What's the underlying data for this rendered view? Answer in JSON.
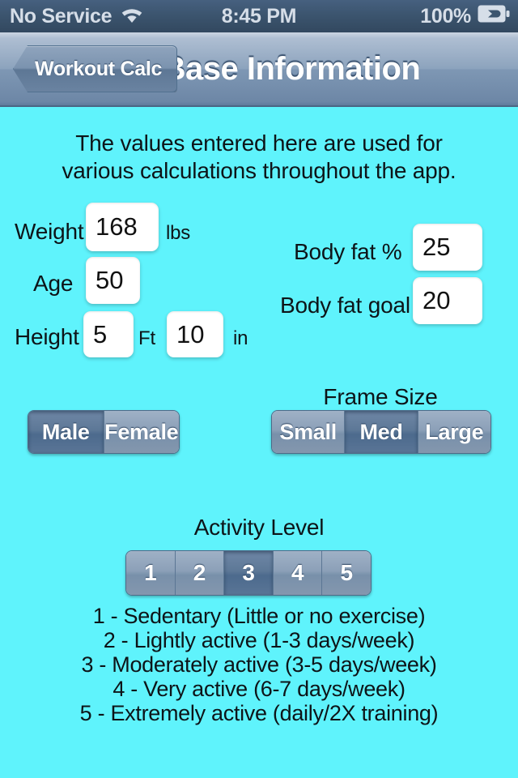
{
  "status_bar": {
    "carrier": "No Service",
    "wifi_icon": "wifi-icon",
    "time": "8:45 PM",
    "battery_percent": "100%",
    "battery_icon": "battery-charging-icon"
  },
  "nav_bar": {
    "back_label": "Workout Calc",
    "title": "Base Information"
  },
  "intro": {
    "line1": "The values entered here are used for",
    "line2": "various calculations throughout the app."
  },
  "form": {
    "weight": {
      "label": "Weight",
      "value": "168",
      "unit": "lbs"
    },
    "age": {
      "label": "Age",
      "value": "50"
    },
    "height": {
      "label": "Height",
      "feet_value": "5",
      "feet_unit": "Ft",
      "inch_value": "10",
      "inch_unit": "in"
    },
    "body_fat": {
      "label": "Body fat %",
      "value": "25"
    },
    "body_fat_goal": {
      "label": "Body fat goal",
      "value": "20"
    }
  },
  "gender": {
    "options": [
      "Male",
      "Female"
    ],
    "selected_index": 0
  },
  "frame_size": {
    "title": "Frame Size",
    "options": [
      "Small",
      "Med",
      "Large"
    ],
    "selected_index": 1
  },
  "activity": {
    "title": "Activity Level",
    "options": [
      "1",
      "2",
      "3",
      "4",
      "5"
    ],
    "selected_index": 2,
    "legend": [
      "1 - Sedentary (Little or no exercise)",
      "2 - Lightly active (1-3 days/week)",
      "3 - Moderately active (3-5 days/week)",
      "4 - Very active (6-7 days/week)",
      "5 - Extremely active (daily/2X training)"
    ]
  },
  "colors": {
    "background": "#5ff3fc",
    "nav_bar": "#8ca3bd",
    "status_bar": "#3c556f",
    "segment_selected": "#5d7897"
  }
}
